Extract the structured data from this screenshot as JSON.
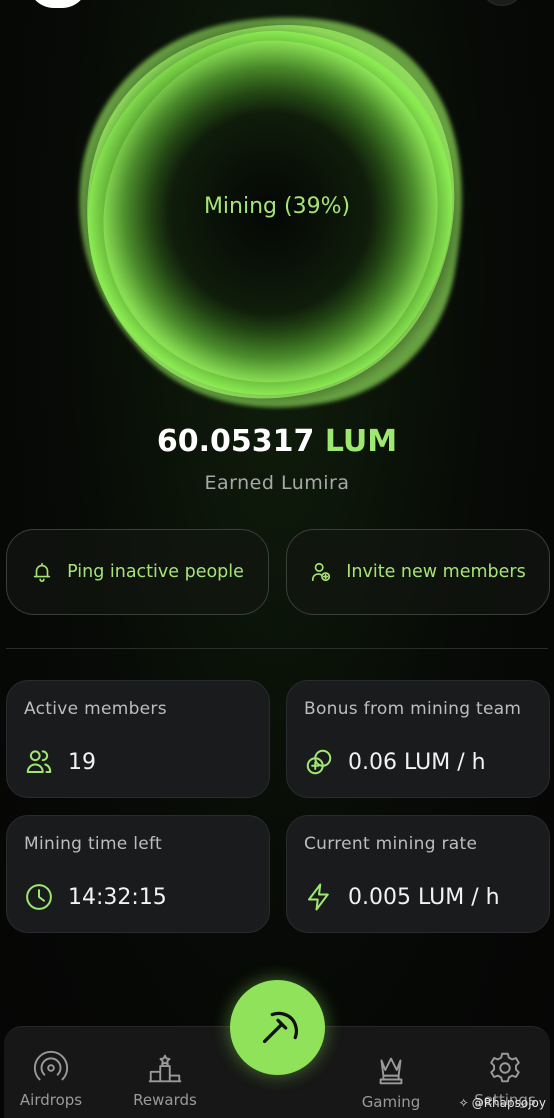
{
  "mining": {
    "status_label": "Mining (39%)",
    "progress_percent": 39
  },
  "balance": {
    "amount": "60.05317",
    "unit": "LUM",
    "caption": "Earned Lumira"
  },
  "actions": {
    "ping_label": "Ping inactive people",
    "invite_label": "Invite new members"
  },
  "stats": {
    "active_members": {
      "title": "Active members",
      "value": "19"
    },
    "bonus": {
      "title": "Bonus from mining team",
      "value": "0.06 LUM / h"
    },
    "time_left": {
      "title": "Mining time left",
      "value": "14:32:15"
    },
    "rate": {
      "title": "Current mining rate",
      "value": "0.005 LUM / h"
    }
  },
  "nav": {
    "airdrops": "Airdrops",
    "rewards": "Rewards",
    "gaming": "Gaming",
    "settings": "Settings"
  },
  "icons": {
    "ping": "bell-icon",
    "invite": "user-plus-icon",
    "members": "users-icon",
    "bonus": "coins-icon",
    "time": "clock-icon",
    "rate": "lightning-icon",
    "mine": "pickaxe-icon",
    "airdrops": "radar-icon",
    "rewards": "podium-icon",
    "gaming": "chess-queen-icon",
    "settings": "gear-icon"
  },
  "colors": {
    "accent": "#9fe870",
    "card_bg": "#1a1b1d",
    "background": "#070a06"
  },
  "watermark": "@Rhapsojoy"
}
